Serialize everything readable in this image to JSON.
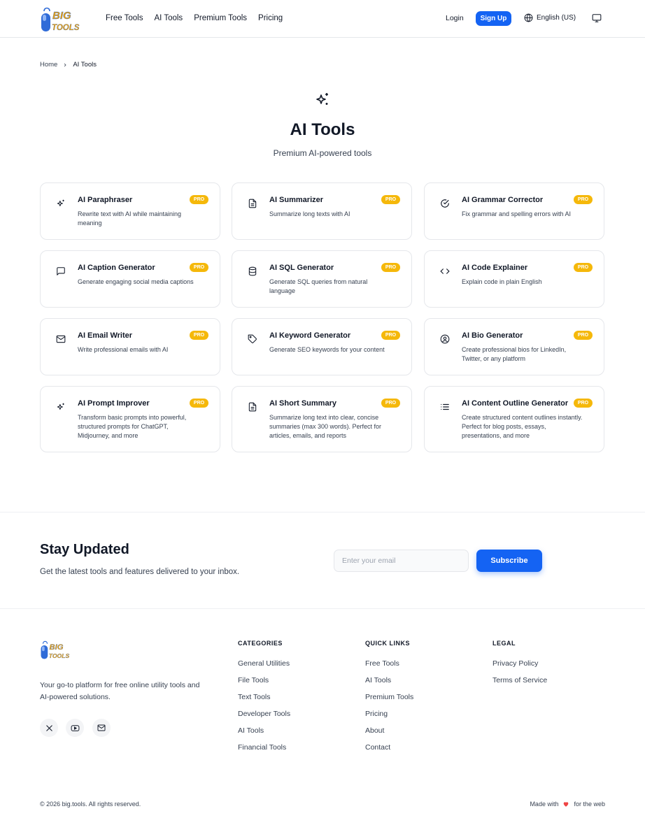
{
  "brand": {
    "top": "BIG",
    "bottom": "TOOLS"
  },
  "nav": {
    "items": [
      "Free Tools",
      "AI Tools",
      "Premium Tools",
      "Pricing"
    ],
    "login": "Login",
    "signup": "Sign Up",
    "language": "English (US)"
  },
  "breadcrumb": {
    "home": "Home",
    "current": "AI Tools"
  },
  "hero": {
    "title": "AI Tools",
    "subtitle": "Premium AI-powered tools"
  },
  "cards": [
    {
      "title": "AI Paraphraser",
      "desc": "Rewrite text with AI while maintaining meaning",
      "badge": "PRO",
      "icon": "sparkles-icon"
    },
    {
      "title": "AI Summarizer",
      "desc": "Summarize long texts with AI",
      "badge": "PRO",
      "icon": "document-icon"
    },
    {
      "title": "AI Grammar Corrector",
      "desc": "Fix grammar and spelling errors with AI",
      "badge": "PRO",
      "icon": "check-circle-icon"
    },
    {
      "title": "AI Caption Generator",
      "desc": "Generate engaging social media captions",
      "badge": "PRO",
      "icon": "chat-icon"
    },
    {
      "title": "AI SQL Generator",
      "desc": "Generate SQL queries from natural language",
      "badge": "PRO",
      "icon": "database-icon"
    },
    {
      "title": "AI Code Explainer",
      "desc": "Explain code in plain English",
      "badge": "PRO",
      "icon": "code-icon"
    },
    {
      "title": "AI Email Writer",
      "desc": "Write professional emails with AI",
      "badge": "PRO",
      "icon": "mail-icon"
    },
    {
      "title": "AI Keyword Generator",
      "desc": "Generate SEO keywords for your content",
      "badge": "PRO",
      "icon": "tag-icon"
    },
    {
      "title": "AI Bio Generator",
      "desc": "Create professional bios for LinkedIn, Twitter, or any platform",
      "badge": "PRO",
      "icon": "user-circle-icon"
    },
    {
      "title": "AI Prompt Improver",
      "desc": "Transform basic prompts into powerful, structured prompts for ChatGPT, Midjourney, and more",
      "badge": "PRO",
      "icon": "sparkles-icon"
    },
    {
      "title": "AI Short Summary",
      "desc": "Summarize long text into clear, concise summaries (max 300 words). Perfect for articles, emails, and reports",
      "badge": "PRO",
      "icon": "document-icon"
    },
    {
      "title": "AI Content Outline Generator",
      "desc": "Create structured content outlines instantly. Perfect for blog posts, essays, presentations, and more",
      "badge": "PRO",
      "icon": "list-icon"
    }
  ],
  "newsletter": {
    "title": "Stay Updated",
    "subtitle": "Get the latest tools and features delivered to your inbox.",
    "placeholder": "Enter your email",
    "button": "Subscribe"
  },
  "footer": {
    "tagline": "Your go-to platform for free online utility tools and AI-powered solutions.",
    "columns": [
      {
        "heading": "CATEGORIES",
        "links": [
          "General Utilities",
          "File Tools",
          "Text Tools",
          "Developer Tools",
          "AI Tools",
          "Financial Tools"
        ]
      },
      {
        "heading": "QUICK LINKS",
        "links": [
          "Free Tools",
          "AI Tools",
          "Premium Tools",
          "Pricing",
          "About",
          "Contact"
        ]
      },
      {
        "heading": "LEGAL",
        "links": [
          "Privacy Policy",
          "Terms of Service"
        ]
      }
    ],
    "copyright": "© 2026 big.tools. All rights reserved.",
    "made_with_prefix": "Made with",
    "made_with_suffix": "for the web"
  },
  "colors": {
    "primary": "#1463f3",
    "pro_badge": "#f5b80a",
    "logo_orange": "#f5a300",
    "logo_blue": "#2f6bd8",
    "heart": "#ef4444"
  }
}
